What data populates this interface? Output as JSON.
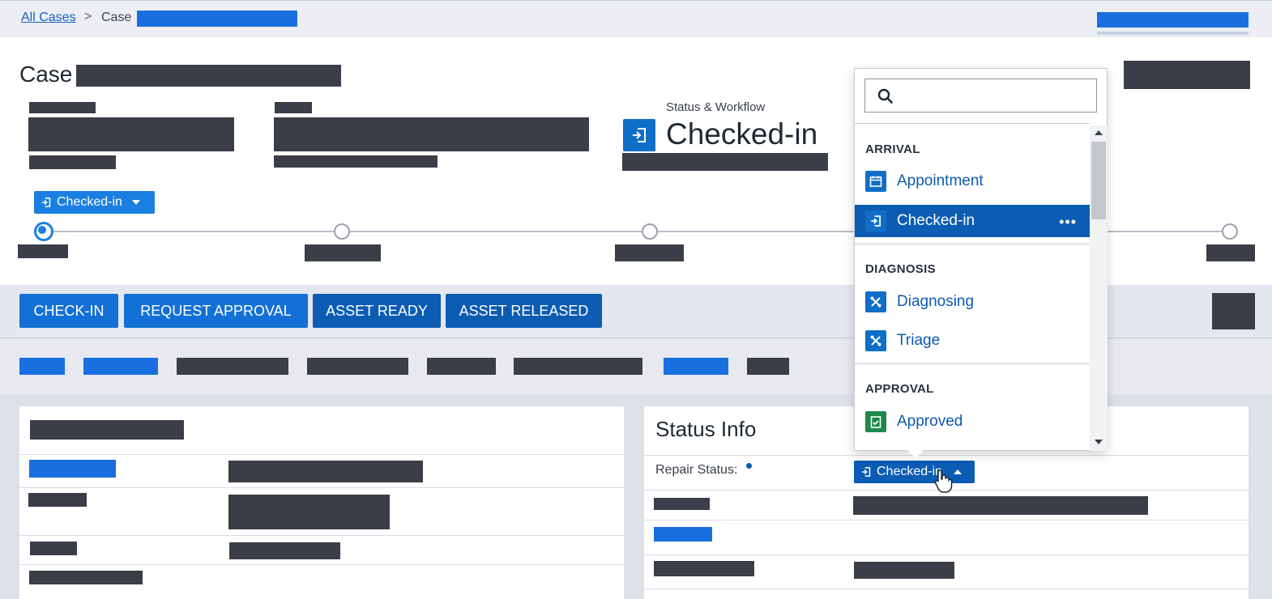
{
  "breadcrumb": {
    "all_cases": "All Cases",
    "separator": ">",
    "case_prefix": "Case"
  },
  "header": {
    "title_prefix": "Case",
    "status_caption": "Status & Workflow",
    "status_value": "Checked-in",
    "stage_pill": "Checked-in"
  },
  "actions": [
    {
      "label": "CHECK-IN"
    },
    {
      "label": "REQUEST APPROVAL"
    },
    {
      "label": "ASSET READY"
    },
    {
      "label": "ASSET RELEASED"
    }
  ],
  "status_panel": {
    "title": "Status Info",
    "repair_status_label": "Repair Status:",
    "repair_status_value": "Checked-in"
  },
  "dropdown": {
    "search_placeholder": "",
    "groups": [
      {
        "heading": "ARRIVAL",
        "items": [
          {
            "label": "Appointment",
            "icon": "calendar-icon"
          },
          {
            "label": "Checked-in",
            "icon": "check-in-icon",
            "selected": true
          }
        ]
      },
      {
        "heading": "DIAGNOSIS",
        "items": [
          {
            "label": "Diagnosing",
            "icon": "tools-icon"
          },
          {
            "label": "Triage",
            "icon": "tools-icon"
          }
        ]
      },
      {
        "heading": "APPROVAL",
        "items": [
          {
            "label": "Approved",
            "icon": "approved-icon"
          }
        ]
      }
    ],
    "more_glyph": "•••"
  },
  "colors": {
    "primary": "#1370d6",
    "primary_dark": "#0c5cb4",
    "approved_green": "#1e8a4a",
    "redaction": "#3b3e47"
  }
}
